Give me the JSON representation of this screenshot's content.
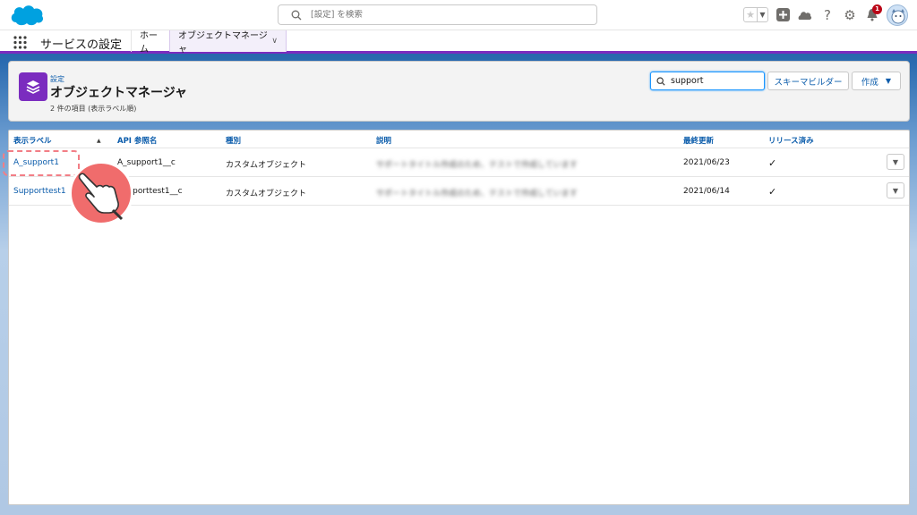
{
  "header": {
    "search_placeholder": "[設定] を検索",
    "notification_count": "1",
    "icons": [
      "salesforce-cloud-logo",
      "star-icon",
      "chevron-down-icon",
      "plus-icon",
      "trailhead-icon",
      "help-icon",
      "gear-icon",
      "bell-icon",
      "avatar"
    ]
  },
  "nav": {
    "app_name": "サービスの設定",
    "tabs": [
      {
        "label": "ホーム"
      },
      {
        "label": "オブジェクトマネージャ"
      }
    ]
  },
  "page_header": {
    "breadcrumb": "設定",
    "title": "オブジェクトマネージャ",
    "item_count": "2 件の項目 (表示ラベル順)",
    "quick_find_value": "support",
    "schema_builder_label": "スキーマビルダー",
    "create_label": "作成"
  },
  "table": {
    "columns": [
      "表示ラベル",
      "API 参照名",
      "種別",
      "説明",
      "最終更新",
      "リリース済み"
    ],
    "rows": [
      {
        "label": "A_support1",
        "api_name": "A_support1__c",
        "type": "カスタムオブジェクト",
        "description": "サポートタイトル作成のため、テストで作成しています",
        "last_modified": "2021/06/23",
        "deployed": "✓"
      },
      {
        "label": "Supporttest1",
        "api_name": "Supporttest1__c",
        "type": "カスタムオブジェクト",
        "description": "サポートタイトル作成のため、テストで作成しています",
        "last_modified": "2021/06/14",
        "deployed": "✓"
      }
    ]
  },
  "colors": {
    "brand_blue": "#0b5cab",
    "accent_purple": "#7b2cbf",
    "highlight_pink": "#f06c6c"
  }
}
